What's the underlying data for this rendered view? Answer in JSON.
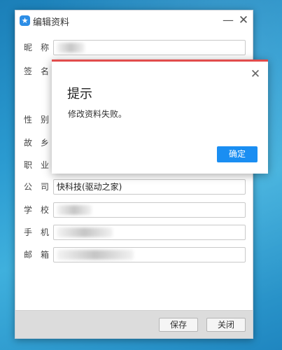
{
  "window": {
    "title": "编辑资料",
    "app_icon_glyph": "★",
    "minimize_glyph": "—",
    "close_glyph": "✕"
  },
  "form": {
    "fields": [
      {
        "label": "昵称",
        "value": ""
      },
      {
        "label": "签名",
        "value": ""
      },
      {
        "label": "性别",
        "value": ""
      },
      {
        "label": "故乡",
        "value": ""
      },
      {
        "label": "职业",
        "value": ""
      },
      {
        "label": "公司",
        "value": "快科技(驱动之家)"
      },
      {
        "label": "学校",
        "value": ""
      },
      {
        "label": "手机",
        "value": ""
      },
      {
        "label": "邮箱",
        "value": ""
      }
    ]
  },
  "footer": {
    "save_label": "保存",
    "close_label": "关闭"
  },
  "dialog": {
    "title": "提示",
    "message": "修改资料失败。",
    "ok_label": "确定",
    "close_glyph": "✕",
    "accent_color": "#e14c4c",
    "button_color": "#1a8ef2"
  }
}
